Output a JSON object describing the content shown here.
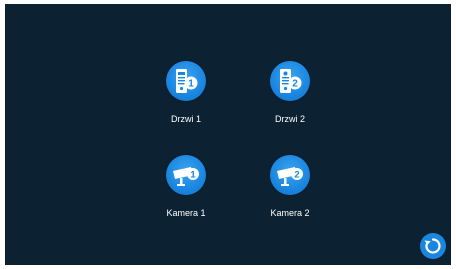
{
  "tiles": [
    {
      "label": "Drzwi 1",
      "icon": "door-intercom-1-icon",
      "badge": "1"
    },
    {
      "label": "Drzwi 2",
      "icon": "door-intercom-2-icon",
      "badge": "2"
    },
    {
      "label": "Kamera 1",
      "icon": "camera-1-icon",
      "badge": "1"
    },
    {
      "label": "Kamera 2",
      "icon": "camera-2-icon",
      "badge": "2"
    }
  ],
  "refresh_icon": "refresh-icon",
  "colors": {
    "background": "#0c2233",
    "accent": "#1a86e0",
    "text": "#ffffff"
  }
}
